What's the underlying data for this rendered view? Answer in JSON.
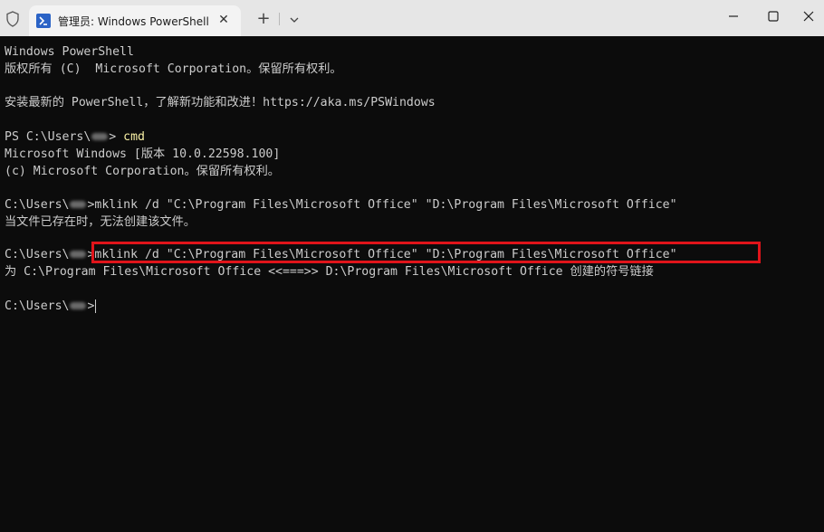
{
  "titlebar": {
    "tab_title": "管理员: Windows PowerShell",
    "close_tab_symbol": "✕",
    "new_tab_symbol": "+",
    "icons": {
      "shield": "shield-icon",
      "tab": "powershell-icon",
      "dropdown": "chevron-down-icon",
      "minimize": "minimize-icon",
      "maximize": "maximize-icon",
      "close": "close-icon"
    }
  },
  "terminal": {
    "line1": "Windows PowerShell",
    "line2": "版权所有 (C)  Microsoft Corporation。保留所有权利。",
    "line3": "安装最新的 PowerShell，了解新功能和改进！https://aka.ms/PSWindows",
    "line4_prefix": "PS C:\\Users\\",
    "line4_suffix": "> ",
    "line4_command": "cmd",
    "line5": "Microsoft Windows [版本 10.0.22598.100]",
    "line6": "(c) Microsoft Corporation。保留所有权利。",
    "line7_prefix": "C:\\Users\\",
    "line7_suffix": ">mklink /d \"C:\\Program Files\\Microsoft Office\" \"D:\\Program Files\\Microsoft Office\"",
    "line8": "当文件已存在时，无法创建该文件。",
    "line9_prefix": "C:\\Users\\",
    "line9_suffix": ">mklink /d \"C:\\Program Files\\Microsoft Office\" \"D:\\Program Files\\Microsoft Office\"",
    "line10": "为 C:\\Program Files\\Microsoft Office <<===>> D:\\Program Files\\Microsoft Office 创建的符号链接",
    "line11_prefix": "C:\\Users\\",
    "line11_suffix": ">"
  },
  "colors": {
    "terminal_bg": "#0c0c0c",
    "terminal_text": "#cccccc",
    "command_highlight": "#f9f1a5",
    "annotation_box": "#e0141a",
    "titlebar_bg": "#e6e6e6"
  }
}
